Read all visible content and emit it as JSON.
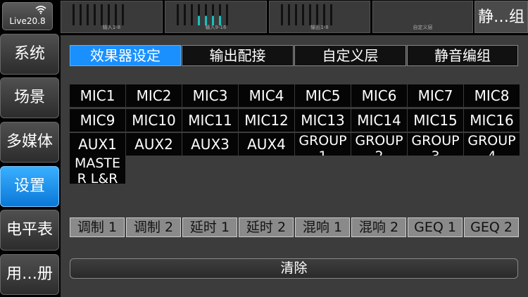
{
  "device": {
    "name": "Live20.8",
    "icon": "wifi-icon"
  },
  "meters": [
    {
      "label": "输入1-8",
      "levels": [
        0,
        0,
        0,
        0,
        0,
        0,
        0,
        0
      ]
    },
    {
      "label": "输入9-16",
      "levels": [
        0,
        0,
        0,
        0.45,
        0.45,
        0.45,
        0.45,
        0
      ]
    },
    {
      "label": "输出1-8",
      "levels": [
        0,
        0,
        0,
        0,
        0,
        0,
        0,
        0
      ]
    },
    {
      "label": "自定义层",
      "levels": []
    }
  ],
  "scene_label": "静…组",
  "sidebar": {
    "items": [
      {
        "label": "系统"
      },
      {
        "label": "场景"
      },
      {
        "label": "多媒体"
      },
      {
        "label": "设置"
      },
      {
        "label": "电平表"
      },
      {
        "label": "用…册"
      }
    ],
    "active_index": 3
  },
  "tabs": [
    {
      "label": "效果器设定"
    },
    {
      "label": "输出配接"
    },
    {
      "label": "自定义层"
    },
    {
      "label": "静音编组"
    }
  ],
  "active_tab": 0,
  "mix_buttons": [
    [
      "MIC1",
      "MIC2",
      "MIC3",
      "MIC4",
      "MIC5",
      "MIC6",
      "MIC7",
      "MIC8"
    ],
    [
      "MIC9",
      "MIC10",
      "MIC11",
      "MIC12",
      "MIC13",
      "MIC14",
      "MIC15",
      "MIC16"
    ],
    [
      "AUX1",
      "AUX2",
      "AUX3",
      "AUX4",
      "GROUP1",
      "GROUP2",
      "GROUP3",
      "GROUP4"
    ],
    [
      "MASTER L&R"
    ]
  ],
  "fx_buttons": [
    "调制 1",
    "调制 2",
    "延时 1",
    "延时 2",
    "混响 1",
    "混响 2",
    "GEQ 1",
    "GEQ 2"
  ],
  "clear_label": "清除",
  "colors": {
    "accent": "#1a90ff",
    "meter_active": "#18c0c0",
    "panel": "#3c3c3c"
  }
}
